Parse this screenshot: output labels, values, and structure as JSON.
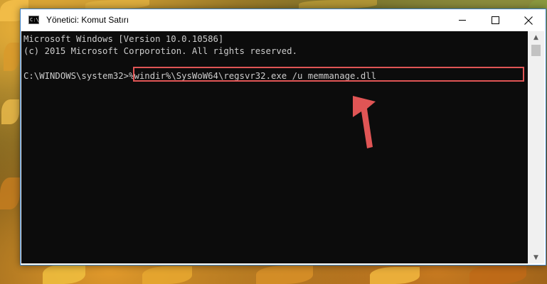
{
  "window": {
    "title": "Yönetici: Komut Satırı"
  },
  "console": {
    "lines": [
      "Microsoft Windows [Version 10.0.10586]",
      "(c) 2015 Microsoft Corporotion. All rights reserved."
    ],
    "prompt": "C:\\WINDOWS\\system32>",
    "command": "%windir%\\SysWoW64\\regsvr32.exe /u memmanage.dll"
  },
  "colors": {
    "console_bg": "#0c0c0c",
    "console_text": "#cccccc",
    "highlight_box": "#e05555",
    "arrow": "#e05555"
  },
  "icons": {
    "app": "cmd-icon",
    "minimize": "minimize-icon",
    "maximize": "maximize-icon",
    "close": "close-icon",
    "scroll_up": "scroll-up-icon",
    "scroll_down": "scroll-down-icon",
    "pointer": "annotation-arrow-icon"
  }
}
